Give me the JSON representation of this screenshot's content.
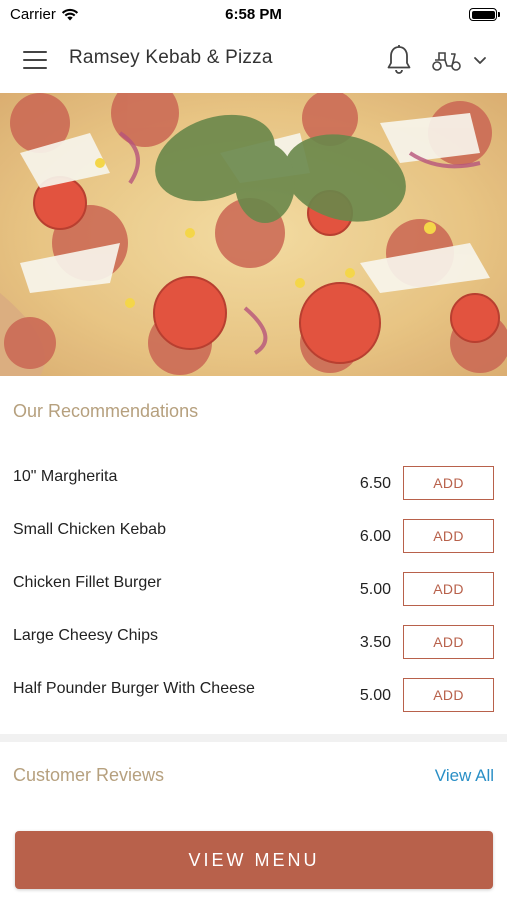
{
  "status_bar": {
    "carrier": "Carrier",
    "time": "6:58 PM"
  },
  "header": {
    "title": "Ramsey Kebab & Pizza"
  },
  "recommendations": {
    "title": "Our Recommendations",
    "items": [
      {
        "name": "10\" Margherita",
        "price": "6.50",
        "add_label": "ADD"
      },
      {
        "name": "Small Chicken Kebab",
        "price": "6.00",
        "add_label": "ADD"
      },
      {
        "name": "Chicken Fillet Burger",
        "price": "5.00",
        "add_label": "ADD"
      },
      {
        "name": "Large Cheesy Chips",
        "price": "3.50",
        "add_label": "ADD"
      },
      {
        "name": "Half Pounder Burger With Cheese",
        "price": "5.00",
        "add_label": "ADD"
      }
    ]
  },
  "reviews": {
    "title": "Customer Reviews",
    "view_all_label": "View All"
  },
  "footer": {
    "view_menu_label": "VIEW MENU"
  },
  "icons": [
    "wifi-icon",
    "battery-icon",
    "menu-icon",
    "bell-icon",
    "scooter-icon",
    "chevron-down-icon"
  ],
  "colors": {
    "accent": "#b8614b",
    "section_title": "#b6a07e",
    "link": "#2a8fc6"
  }
}
